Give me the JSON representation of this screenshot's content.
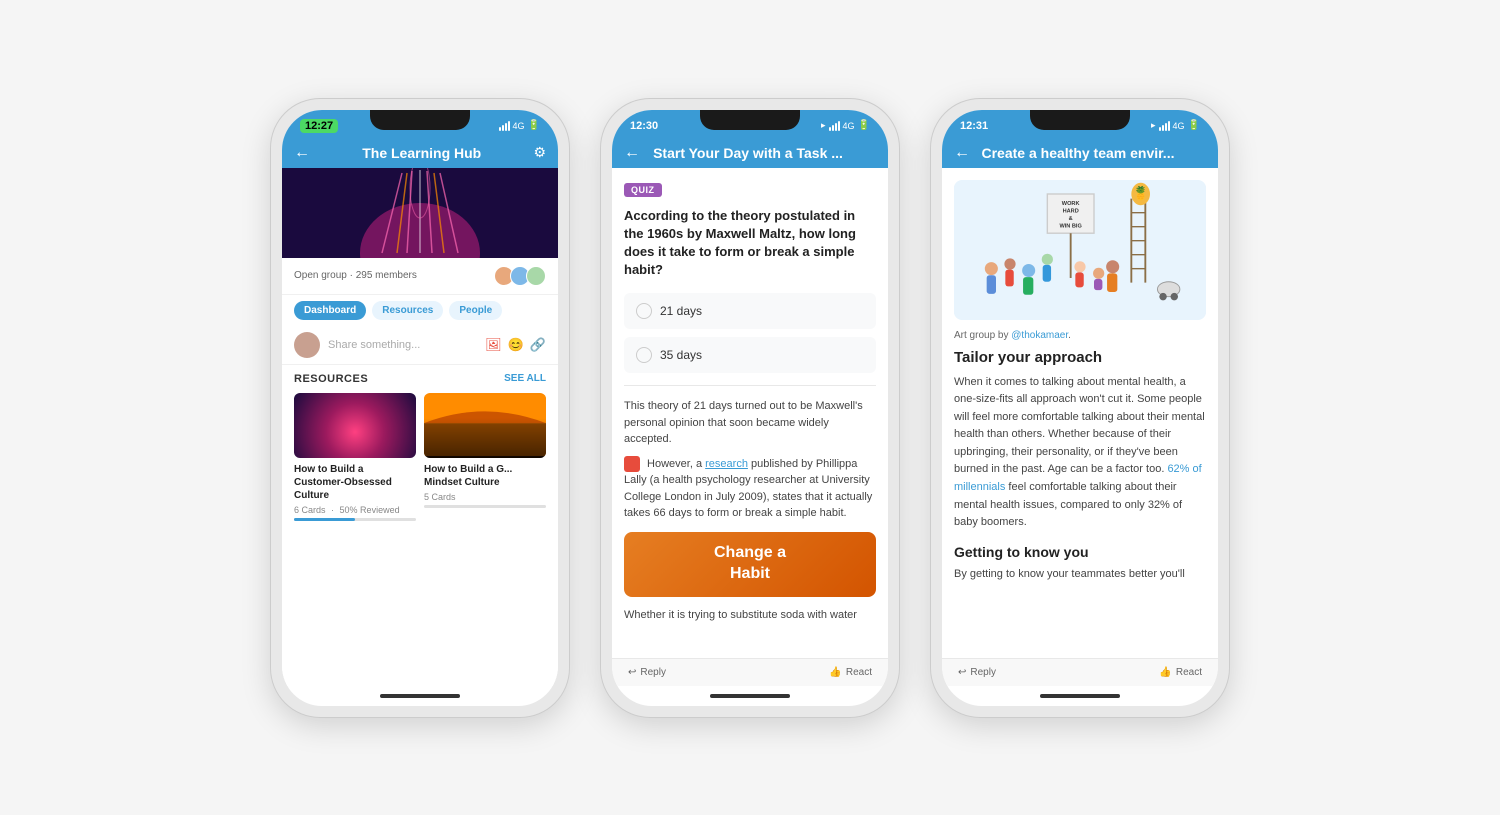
{
  "page": {
    "background": "#f5f5f5"
  },
  "phone1": {
    "status": {
      "time": "12:27",
      "time_style": "badge",
      "signal": "4G",
      "battery": "■"
    },
    "header": {
      "title": "The Learning Hub",
      "back_icon": "←",
      "settings_icon": "⚙"
    },
    "group": {
      "type": "Open group",
      "members": "295 members"
    },
    "tabs": [
      "Dashboard",
      "Resources",
      "People"
    ],
    "share_placeholder": "Share something...",
    "resources_title": "RESOURCES",
    "see_all": "SEE ALL",
    "cards": [
      {
        "title": "How to Build a Customer-Obsessed Culture",
        "cards_count": "6 Cards",
        "reviewed": "50% Reviewed",
        "progress": 50
      },
      {
        "title": "How to Build a Growth Mindset Culture",
        "cards_count": "5 Cards",
        "reviewed": "",
        "progress": 0
      }
    ]
  },
  "phone2": {
    "status": {
      "time": "12:30",
      "signal": "4G",
      "battery": "■"
    },
    "header": {
      "title": "Start Your Day with a Task ...",
      "back_icon": "←"
    },
    "quiz_badge": "QUIZ",
    "question": "According to the theory postulated in the 1960s by Maxwell Maltz, how long does it take to form or break a simple habit?",
    "options": [
      "21 days",
      "35 days"
    ],
    "answer_text": "This theory of 21 days turned out to be Maxwell's personal opinion that soon became widely accepted.",
    "research_text": "However, a research published by Phillippa Lally (a health psychology researcher at University College London in July 2009), states that it actually takes 66 days to form or break a simple habit.",
    "research_link": "research",
    "banner_text": "Change a\nHabit",
    "footer_text": "Whether it is trying to substitute soda with water",
    "bottom_actions": [
      "Reply",
      "React"
    ]
  },
  "phone3": {
    "status": {
      "time": "12:31",
      "signal": "4G",
      "battery": "■"
    },
    "header": {
      "title": "Create a healthy team envir...",
      "back_icon": "←"
    },
    "art_caption": "Art group by @thokamaer.",
    "art_author_link": "@thokamaer",
    "sign_text": "WORK\nHARD\n& \nWIN\nBIG",
    "heading": "Tailor your approach",
    "body": "When it comes to talking about mental health, a one-size-fits all approach won't cut it. Some people will feel more comfortable talking about their mental health than others. Whether because of their upbringing, their personality, or if they've been burned in the past. Age can be a factor too. 62% of millennials feel comfortable talking about their mental health issues, compared to only 32% of baby boomers.",
    "millennials_link": "62% of millennials",
    "subheading": "Getting to know you",
    "sub_body": "By getting to know your teammates better you'll",
    "bottom_actions": [
      "Reply",
      "React"
    ]
  }
}
